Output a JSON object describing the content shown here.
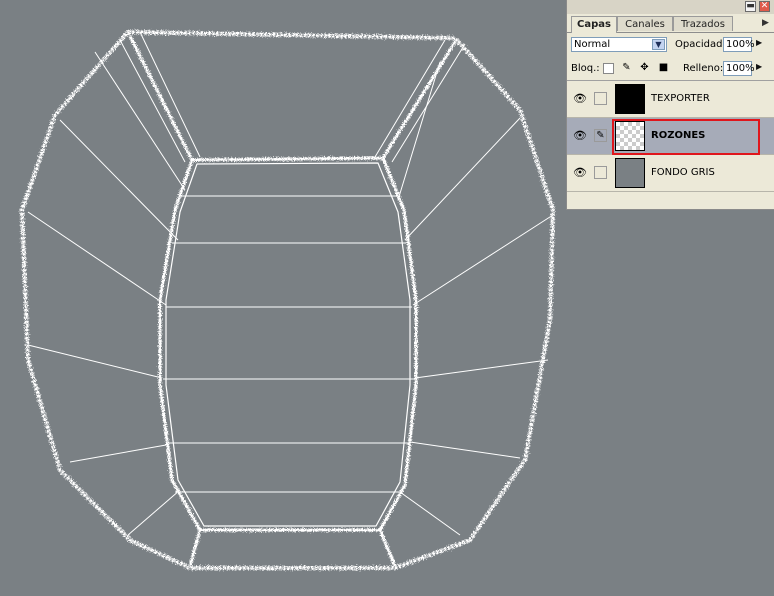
{
  "panel": {
    "tabs": [
      "Capas",
      "Canales",
      "Trazados"
    ],
    "blend_mode": "Normal",
    "opacity_label": "Opacidad:",
    "opacity_value": "100%",
    "lock_label": "Bloq.:",
    "fill_label": "Relleno:",
    "fill_value": "100%",
    "minimize": "▬",
    "close": "✕",
    "menu_arrow": "▶"
  },
  "layers": [
    {
      "name": "TEXPORTER",
      "visible": true,
      "selected": false
    },
    {
      "name": "ROZONES",
      "visible": true,
      "selected": true
    },
    {
      "name": "FONDO GRIS",
      "visible": true,
      "selected": false
    }
  ],
  "colors": {
    "background": "#7a8084",
    "wireframe": "#ffffff",
    "selection_highlight": "#e0161c"
  },
  "icons": {
    "eye": "eye-icon",
    "brush": "brush-link-icon",
    "lock_transparency": "checker-lock-icon",
    "lock_paint": "brush-lock-icon",
    "lock_move": "move-lock-icon",
    "lock_all": "padlock-icon"
  }
}
